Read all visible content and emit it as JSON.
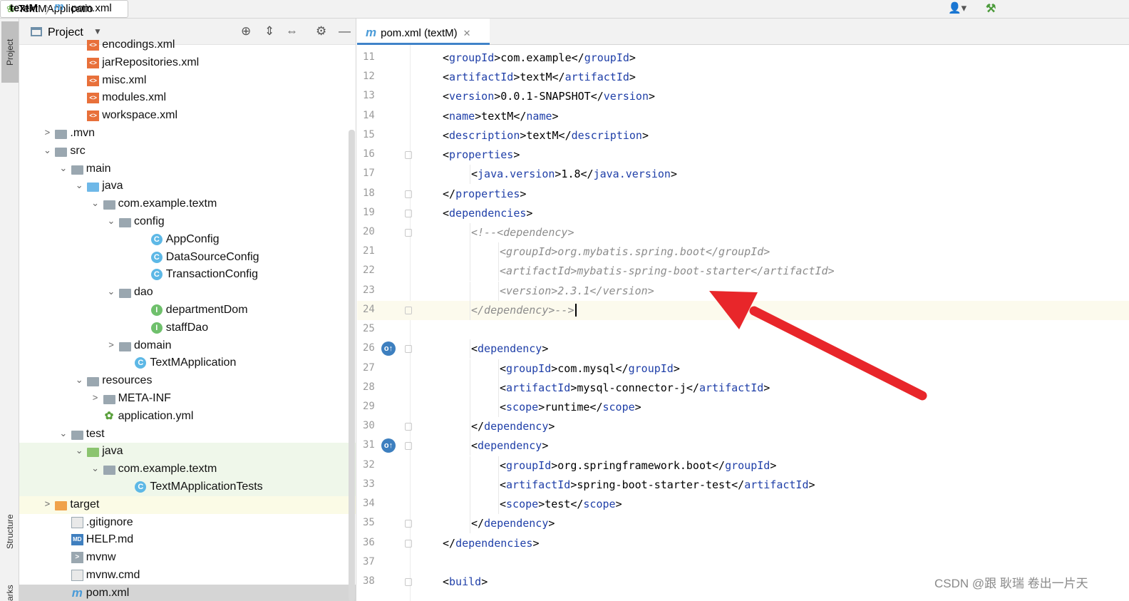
{
  "navbar": {
    "project": "textM",
    "separator": "〉",
    "file_icon": "m",
    "file": "pom.xml",
    "user_icon": "👤▾",
    "build_icon": "hammer-icon",
    "run_config": "TextMApplicatio",
    "run_config_icon": "spring-boot-icon"
  },
  "stripe": {
    "project": "Project",
    "structure": "Structure",
    "bookmarks": "arks"
  },
  "project_panel": {
    "title": "Project",
    "caret": "▼",
    "tools": {
      "locate": "⊕",
      "expand": "⇕",
      "collapse": "⇔",
      "settings": "⚙",
      "hide": "—"
    }
  },
  "tree": [
    {
      "indent": 3,
      "arrow": "",
      "icon": "xml",
      "icon_text": "<>",
      "label": "encodings.xml"
    },
    {
      "indent": 3,
      "arrow": "",
      "icon": "xml",
      "icon_text": "<>",
      "label": "jarRepositories.xml"
    },
    {
      "indent": 3,
      "arrow": "",
      "icon": "xml",
      "icon_text": "<>",
      "label": "misc.xml"
    },
    {
      "indent": 3,
      "arrow": "",
      "icon": "xml",
      "icon_text": "<>",
      "label": "modules.xml"
    },
    {
      "indent": 3,
      "arrow": "",
      "icon": "xml",
      "icon_text": "<>",
      "label": "workspace.xml"
    },
    {
      "indent": 1,
      "arrow": ">",
      "icon": "folder",
      "icon_text": "",
      "label": ".mvn"
    },
    {
      "indent": 1,
      "arrow": "⌄",
      "icon": "folder",
      "icon_text": "",
      "label": "src"
    },
    {
      "indent": 2,
      "arrow": "⌄",
      "icon": "folder",
      "icon_text": "",
      "label": "main"
    },
    {
      "indent": 3,
      "arrow": "⌄",
      "icon": "folder-blue",
      "icon_text": "",
      "label": "java"
    },
    {
      "indent": 4,
      "arrow": "⌄",
      "icon": "pkg",
      "icon_text": "",
      "label": "com.example.textm"
    },
    {
      "indent": 5,
      "arrow": "⌄",
      "icon": "pkg",
      "icon_text": "",
      "label": "config"
    },
    {
      "indent": 7,
      "arrow": "",
      "icon": "class",
      "icon_text": "C",
      "label": "AppConfig"
    },
    {
      "indent": 7,
      "arrow": "",
      "icon": "class",
      "icon_text": "C",
      "label": "DataSourceConfig"
    },
    {
      "indent": 7,
      "arrow": "",
      "icon": "class",
      "icon_text": "C",
      "label": "TransactionConfig"
    },
    {
      "indent": 5,
      "arrow": "⌄",
      "icon": "pkg",
      "icon_text": "",
      "label": "dao"
    },
    {
      "indent": 7,
      "arrow": "",
      "icon": "iface",
      "icon_text": "I",
      "label": "departmentDom"
    },
    {
      "indent": 7,
      "arrow": "",
      "icon": "iface",
      "icon_text": "I",
      "label": "staffDao"
    },
    {
      "indent": 5,
      "arrow": ">",
      "icon": "pkg",
      "icon_text": "",
      "label": "domain"
    },
    {
      "indent": 6,
      "arrow": "",
      "icon": "app",
      "icon_text": "C",
      "label": "TextMApplication"
    },
    {
      "indent": 3,
      "arrow": "⌄",
      "icon": "folder",
      "icon_text": "",
      "label": "resources"
    },
    {
      "indent": 4,
      "arrow": ">",
      "icon": "folder",
      "icon_text": "",
      "label": "META-INF"
    },
    {
      "indent": 4,
      "arrow": "",
      "icon": "yml",
      "icon_text": "✿",
      "label": "application.yml"
    },
    {
      "indent": 2,
      "arrow": "⌄",
      "icon": "folder",
      "icon_text": "",
      "label": "test",
      "hl": ""
    },
    {
      "indent": 3,
      "arrow": "⌄",
      "icon": "folder-green",
      "icon_text": "",
      "label": "java",
      "hl": "green"
    },
    {
      "indent": 4,
      "arrow": "⌄",
      "icon": "pkg",
      "icon_text": "",
      "label": "com.example.textm",
      "hl": "green"
    },
    {
      "indent": 6,
      "arrow": "",
      "icon": "app",
      "icon_text": "C",
      "label": "TextMApplicationTests",
      "hl": "green"
    },
    {
      "indent": 1,
      "arrow": ">",
      "icon": "folder-orange",
      "icon_text": "",
      "label": "target",
      "hl": "yellow"
    },
    {
      "indent": 2,
      "arrow": "",
      "icon": "file",
      "icon_text": "",
      "label": ".gitignore"
    },
    {
      "indent": 2,
      "arrow": "",
      "icon": "md",
      "icon_text": "MD",
      "label": "HELP.md"
    },
    {
      "indent": 2,
      "arrow": "",
      "icon": "term",
      "icon_text": ">",
      "label": "mvnw"
    },
    {
      "indent": 2,
      "arrow": "",
      "icon": "file",
      "icon_text": "",
      "label": "mvnw.cmd"
    },
    {
      "indent": 2,
      "arrow": "",
      "icon": "maven",
      "icon_text": "m",
      "label": "pom.xml",
      "hl": "selected"
    }
  ],
  "editor": {
    "tab": {
      "icon": "m",
      "label": "pom.xml (textM)",
      "close": "✕"
    },
    "lines": [
      {
        "n": "11",
        "indent": 1,
        "parts": [
          [
            "t",
            "<"
          ],
          [
            "tag",
            "groupId"
          ],
          [
            "t",
            ">com.example</"
          ],
          [
            "tag",
            "groupId"
          ],
          [
            "t",
            ">"
          ]
        ]
      },
      {
        "n": "12",
        "indent": 1,
        "parts": [
          [
            "t",
            "<"
          ],
          [
            "tag",
            "artifactId"
          ],
          [
            "t",
            ">textM</"
          ],
          [
            "tag",
            "artifactId"
          ],
          [
            "t",
            ">"
          ]
        ]
      },
      {
        "n": "13",
        "indent": 1,
        "parts": [
          [
            "t",
            "<"
          ],
          [
            "tag",
            "version"
          ],
          [
            "t",
            ">0.0.1-SNAPSHOT</"
          ],
          [
            "tag",
            "version"
          ],
          [
            "t",
            ">"
          ]
        ]
      },
      {
        "n": "14",
        "indent": 1,
        "parts": [
          [
            "t",
            "<"
          ],
          [
            "tag",
            "name"
          ],
          [
            "t",
            ">textM</"
          ],
          [
            "tag",
            "name"
          ],
          [
            "t",
            ">"
          ]
        ]
      },
      {
        "n": "15",
        "indent": 1,
        "parts": [
          [
            "t",
            "<"
          ],
          [
            "tag",
            "description"
          ],
          [
            "t",
            ">textM</"
          ],
          [
            "tag",
            "description"
          ],
          [
            "t",
            ">"
          ]
        ]
      },
      {
        "n": "16",
        "indent": 1,
        "fold": true,
        "parts": [
          [
            "t",
            "<"
          ],
          [
            "tag",
            "properties"
          ],
          [
            "t",
            ">"
          ]
        ]
      },
      {
        "n": "17",
        "indent": 2,
        "parts": [
          [
            "t",
            "<"
          ],
          [
            "tag",
            "java.version"
          ],
          [
            "t",
            ">1.8</"
          ],
          [
            "tag",
            "java.version"
          ],
          [
            "t",
            ">"
          ]
        ]
      },
      {
        "n": "18",
        "indent": 1,
        "fold": true,
        "parts": [
          [
            "t",
            "</"
          ],
          [
            "tag",
            "properties"
          ],
          [
            "t",
            ">"
          ]
        ]
      },
      {
        "n": "19",
        "indent": 1,
        "fold": true,
        "parts": [
          [
            "t",
            "<"
          ],
          [
            "tag",
            "dependencies"
          ],
          [
            "t",
            ">"
          ]
        ]
      },
      {
        "n": "20",
        "indent": 2,
        "fold": true,
        "parts": [
          [
            "cm",
            "<!--<dependency>"
          ]
        ]
      },
      {
        "n": "21",
        "indent": 3,
        "parts": [
          [
            "cm",
            "<groupId>org.mybatis.spring.boot</groupId>"
          ]
        ]
      },
      {
        "n": "22",
        "indent": 3,
        "parts": [
          [
            "cm",
            "<artifactId>mybatis-spring-boot-starter</artifactId>"
          ]
        ]
      },
      {
        "n": "23",
        "indent": 3,
        "parts": [
          [
            "cm",
            "<version>2.3.1</version>"
          ]
        ]
      },
      {
        "n": "24",
        "indent": 2,
        "fold": true,
        "current": true,
        "caret": true,
        "parts": [
          [
            "cm",
            "</dependency>-->"
          ]
        ]
      },
      {
        "n": "25",
        "indent": 0,
        "parts": []
      },
      {
        "n": "26",
        "indent": 2,
        "gutter": true,
        "fold": true,
        "parts": [
          [
            "t",
            "<"
          ],
          [
            "tag",
            "dependency"
          ],
          [
            "t",
            ">"
          ]
        ]
      },
      {
        "n": "27",
        "indent": 3,
        "parts": [
          [
            "t",
            "<"
          ],
          [
            "tag",
            "groupId"
          ],
          [
            "t",
            ">com.mysql</"
          ],
          [
            "tag",
            "groupId"
          ],
          [
            "t",
            ">"
          ]
        ]
      },
      {
        "n": "28",
        "indent": 3,
        "parts": [
          [
            "t",
            "<"
          ],
          [
            "tag",
            "artifactId"
          ],
          [
            "t",
            ">mysql-connector-j</"
          ],
          [
            "tag",
            "artifactId"
          ],
          [
            "t",
            ">"
          ]
        ]
      },
      {
        "n": "29",
        "indent": 3,
        "parts": [
          [
            "t",
            "<"
          ],
          [
            "tag",
            "scope"
          ],
          [
            "t",
            ">runtime</"
          ],
          [
            "tag",
            "scope"
          ],
          [
            "t",
            ">"
          ]
        ]
      },
      {
        "n": "30",
        "indent": 2,
        "fold": true,
        "parts": [
          [
            "t",
            "</"
          ],
          [
            "tag",
            "dependency"
          ],
          [
            "t",
            ">"
          ]
        ]
      },
      {
        "n": "31",
        "indent": 2,
        "gutter": true,
        "fold": true,
        "parts": [
          [
            "t",
            "<"
          ],
          [
            "tag",
            "dependency"
          ],
          [
            "t",
            ">"
          ]
        ]
      },
      {
        "n": "32",
        "indent": 3,
        "parts": [
          [
            "t",
            "<"
          ],
          [
            "tag",
            "groupId"
          ],
          [
            "t",
            ">org.springframework.boot</"
          ],
          [
            "tag",
            "groupId"
          ],
          [
            "t",
            ">"
          ]
        ]
      },
      {
        "n": "33",
        "indent": 3,
        "parts": [
          [
            "t",
            "<"
          ],
          [
            "tag",
            "artifactId"
          ],
          [
            "t",
            ">spring-boot-starter-test</"
          ],
          [
            "tag",
            "artifactId"
          ],
          [
            "t",
            ">"
          ]
        ]
      },
      {
        "n": "34",
        "indent": 3,
        "parts": [
          [
            "t",
            "<"
          ],
          [
            "tag",
            "scope"
          ],
          [
            "t",
            ">test</"
          ],
          [
            "tag",
            "scope"
          ],
          [
            "t",
            ">"
          ]
        ]
      },
      {
        "n": "35",
        "indent": 2,
        "fold": true,
        "parts": [
          [
            "t",
            "</"
          ],
          [
            "tag",
            "dependency"
          ],
          [
            "t",
            ">"
          ]
        ]
      },
      {
        "n": "36",
        "indent": 1,
        "fold": true,
        "parts": [
          [
            "t",
            "</"
          ],
          [
            "tag",
            "dependencies"
          ],
          [
            "t",
            ">"
          ]
        ]
      },
      {
        "n": "37",
        "indent": 0,
        "parts": []
      },
      {
        "n": "38",
        "indent": 1,
        "fold": true,
        "parts": [
          [
            "t",
            "<"
          ],
          [
            "tag",
            "build"
          ],
          [
            "t",
            ">"
          ]
        ]
      }
    ]
  },
  "annotation": {
    "color": "#e8262a",
    "icon": "red-arrow"
  },
  "watermark": "CSDN @跟 耿瑞 卷出一片天"
}
